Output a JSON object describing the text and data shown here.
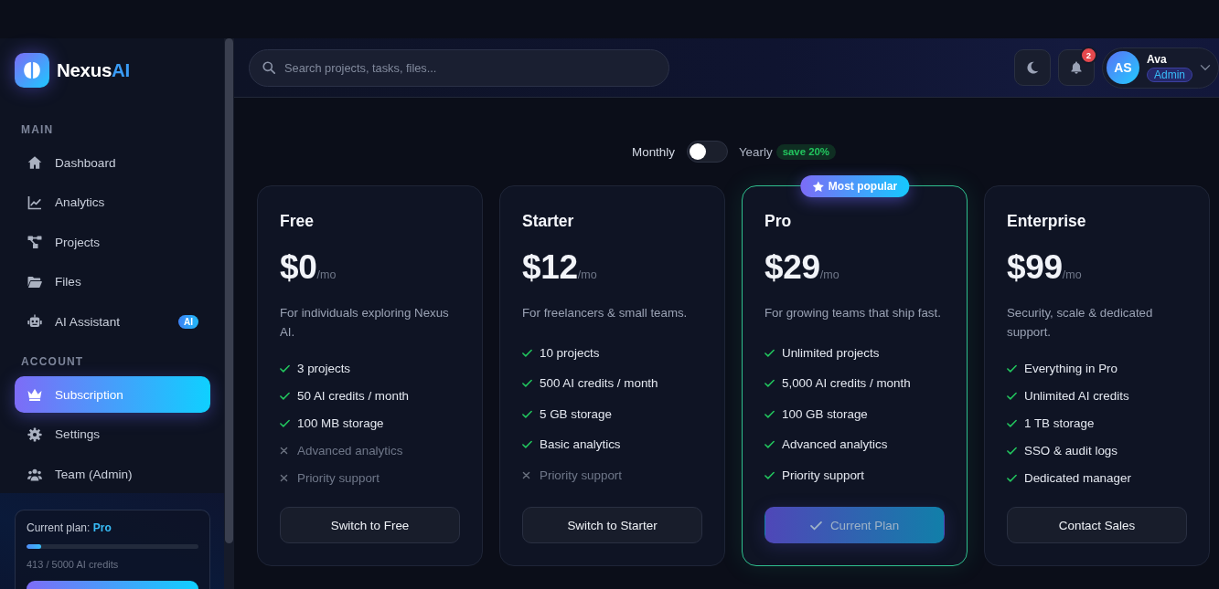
{
  "brand": {
    "name": "Nexus",
    "accent": "AI"
  },
  "sidebar": {
    "sections": [
      {
        "title": "MAIN",
        "items": [
          {
            "label": "Dashboard",
            "selected": false
          },
          {
            "label": "Analytics",
            "selected": false
          },
          {
            "label": "Projects",
            "selected": false
          },
          {
            "label": "Files",
            "selected": false
          },
          {
            "label": "AI Assistant",
            "badge": "AI",
            "selected": false
          }
        ]
      },
      {
        "title": "ACCOUNT",
        "items": [
          {
            "label": "Subscription",
            "selected": true
          },
          {
            "label": "Settings",
            "selected": false
          },
          {
            "label": "Team (Admin)",
            "selected": false
          }
        ]
      }
    ],
    "plan_summary": {
      "text": "Current plan: **Pro**",
      "level": 0.083,
      "usage": "413 / 5000 AI credits"
    }
  },
  "header": {
    "search": {
      "placeholder": "Search projects, tasks, files..."
    },
    "notifications": "2",
    "user": {
      "initials": "AS",
      "name": "Ava",
      "role": "Admin"
    }
  },
  "billing": {
    "monthly_label": "Monthly",
    "yearly_label": "Yearly",
    "yearly": false,
    "discount": "save 20%"
  },
  "plans": [
    {
      "name": "Free",
      "price": "$0",
      "period": "/mo",
      "description": "For individuals exploring Nexus AI.",
      "features": [
        {
          "text": "3 projects",
          "included": true
        },
        {
          "text": "50 AI credits / month",
          "included": true
        },
        {
          "text": "100 MB storage",
          "included": true
        },
        {
          "text": "Advanced analytics",
          "included": false
        },
        {
          "text": "Priority support",
          "included": false
        }
      ],
      "button": "Switch to Free",
      "current": false,
      "featured": false
    },
    {
      "name": "Starter",
      "price": "$12",
      "period": "/mo",
      "description": "For freelancers & small teams.",
      "features": [
        {
          "text": "10 projects",
          "included": true
        },
        {
          "text": "500 AI credits / month",
          "included": true
        },
        {
          "text": "5 GB storage",
          "included": true
        },
        {
          "text": "Basic analytics",
          "included": true
        },
        {
          "text": "Priority support",
          "included": false
        }
      ],
      "button": "Switch to Starter",
      "current": false,
      "featured": false
    },
    {
      "name": "Pro",
      "badge": "Most popular",
      "price": "$29",
      "period": "/mo",
      "description": "For growing teams that ship fast.",
      "features": [
        {
          "text": "Unlimited projects",
          "included": true
        },
        {
          "text": "5,000 AI credits / month",
          "included": true
        },
        {
          "text": "100 GB storage",
          "included": true
        },
        {
          "text": "Advanced analytics",
          "included": true
        },
        {
          "text": "Priority support",
          "included": true
        }
      ],
      "button": "Current Plan",
      "current": true,
      "featured": true
    },
    {
      "name": "Enterprise",
      "price": "$99",
      "period": "/mo",
      "description": "Security, scale & dedicated support.",
      "features": [
        {
          "text": "Everything in Pro",
          "included": true
        },
        {
          "text": "Unlimited AI credits",
          "included": true
        },
        {
          "text": "1 TB storage",
          "included": true
        },
        {
          "text": "SSO & audit logs",
          "included": true
        },
        {
          "text": "Dedicated manager",
          "included": true
        }
      ],
      "button": "Contact Sales",
      "current": false,
      "featured": false
    }
  ]
}
